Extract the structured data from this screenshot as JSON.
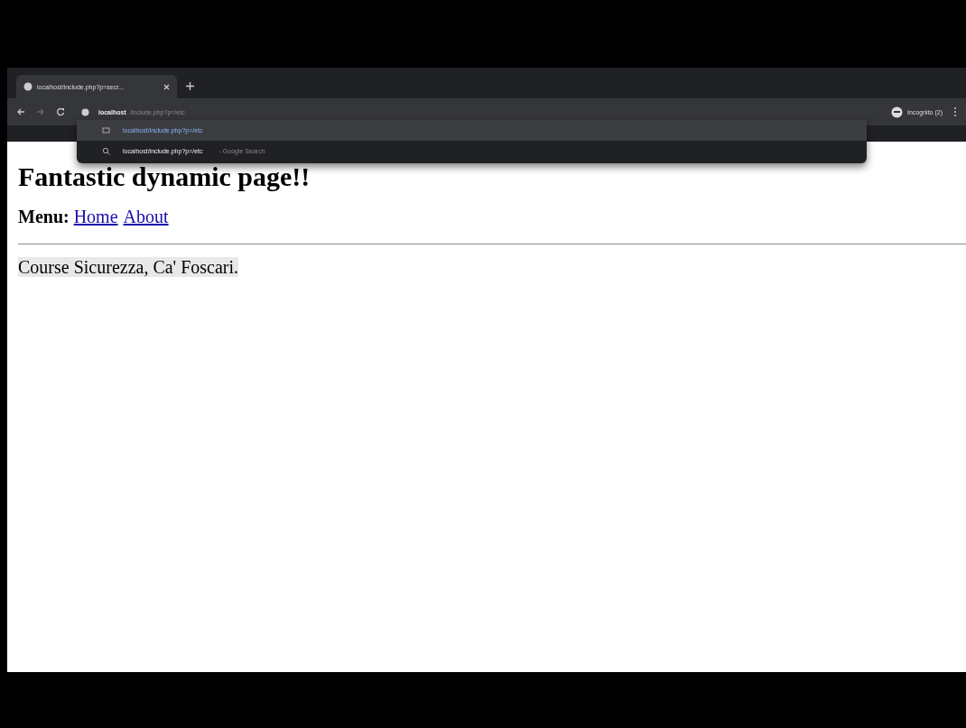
{
  "browser": {
    "tab_title": "localhost/include.php?p=secr...",
    "address": {
      "host": "localhost",
      "path": "/include.php?p=/etc"
    },
    "suggestions": [
      {
        "kind": "url",
        "text": "localhost/include.php?p=/etc",
        "selected": true
      },
      {
        "kind": "search",
        "text": "localhost/include.php?p=/etc",
        "hint": "- Google Search",
        "selected": false
      }
    ],
    "profile": "Incognito (2)"
  },
  "page": {
    "heading": "Fantastic dynamic page!!",
    "menu_label": "Menu:",
    "menu_links": [
      "Home",
      "About"
    ],
    "footer": "Course Sicurezza, Ca' Foscari."
  }
}
